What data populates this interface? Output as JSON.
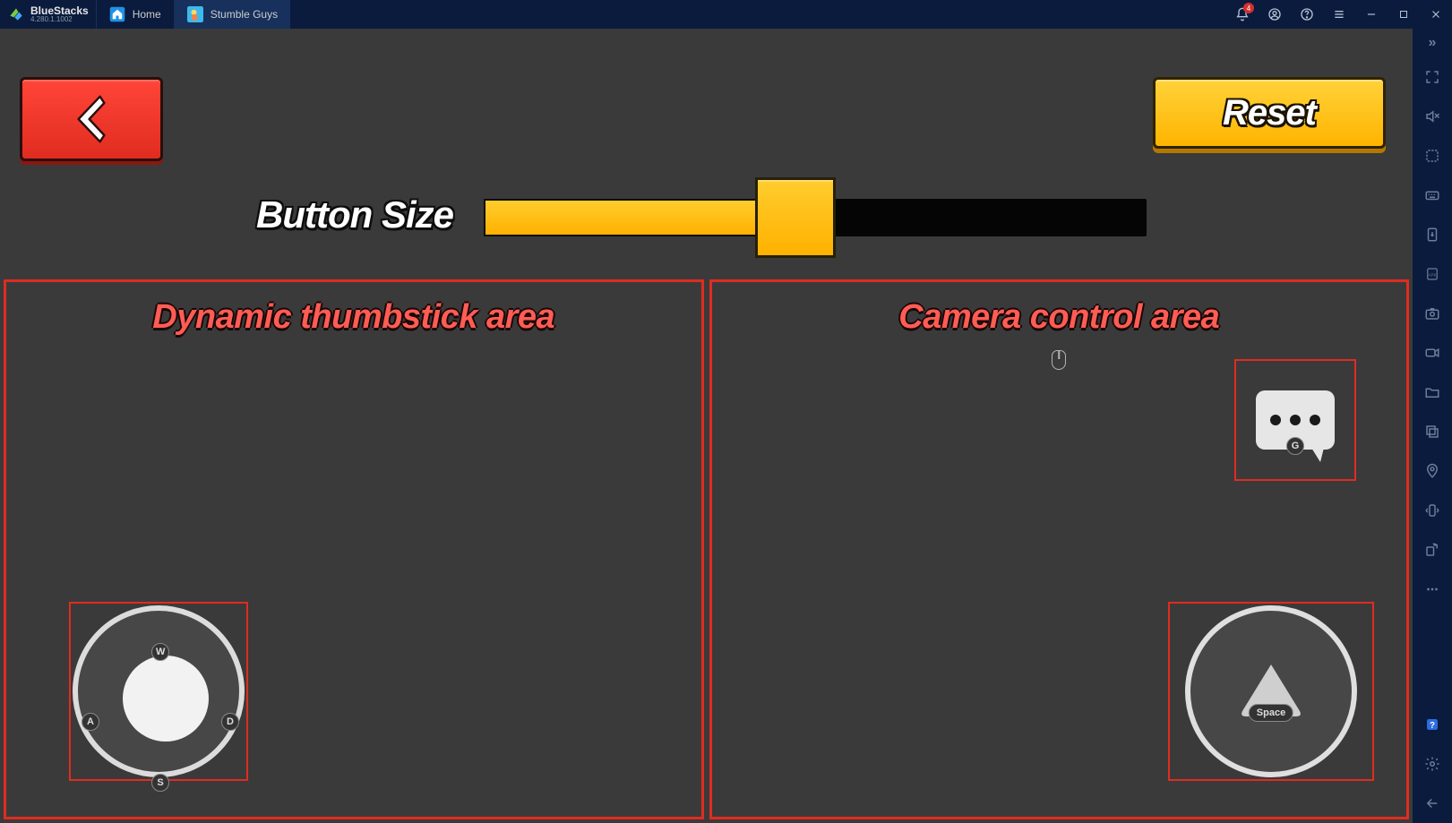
{
  "titlebar": {
    "app_name": "BlueStacks",
    "app_version": "4.280.1.1002",
    "tabs": [
      {
        "label": "Home",
        "active": false
      },
      {
        "label": "Stumble Guys",
        "active": true
      }
    ],
    "notification_count": "4"
  },
  "game_ui": {
    "reset_label": "Reset",
    "size_label": "Button Size",
    "slider_percent": 44,
    "thumbstick_area_title": "Dynamic thumbstick area",
    "camera_area_title": "Camera control area",
    "keys": {
      "up": "W",
      "left": "A",
      "right": "D",
      "down": "S",
      "chat": "G",
      "jump": "Space"
    }
  }
}
